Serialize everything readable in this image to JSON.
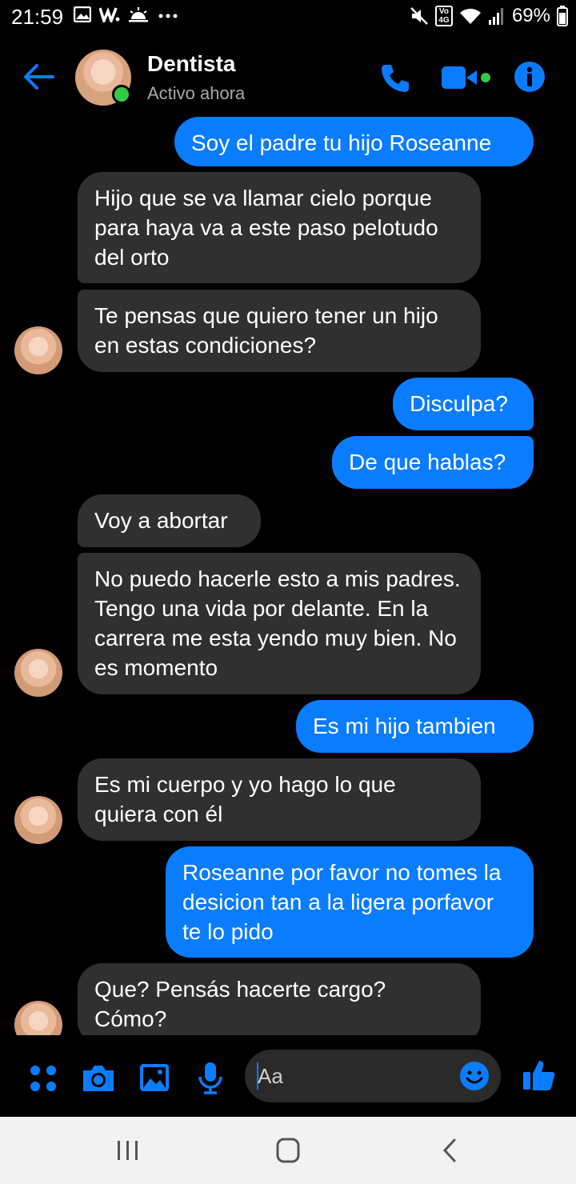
{
  "status_bar": {
    "time": "21:59",
    "battery": "69%",
    "network": "4G",
    "network_prefix": "Vo",
    "left_icons": [
      "gallery-icon",
      "w-app-icon",
      "weather-icon",
      "more-dots-icon"
    ],
    "right_icons": [
      "mute-icon",
      "volte-icon",
      "wifi-icon",
      "signal-icon",
      "battery-icon"
    ]
  },
  "header": {
    "contact_name": "Dentista",
    "contact_status": "Activo ahora",
    "accent": "#0a7cff",
    "online_color": "#31cc46"
  },
  "messages": [
    {
      "direction": "out",
      "text": "Soy el padre tu hijo Roseanne"
    },
    {
      "direction": "in",
      "text": "Hijo que se va llamar cielo porque para haya va a este paso pelotudo del orto"
    },
    {
      "direction": "in",
      "text": "Te pensas que quiero tener un hijo en estas condiciones?"
    },
    {
      "direction": "out",
      "text": "Disculpa?"
    },
    {
      "direction": "out",
      "text": "De que hablas?"
    },
    {
      "direction": "in",
      "text": "Voy a abortar"
    },
    {
      "direction": "in",
      "text": "No puedo hacerle esto a mis padres. Tengo una vida por delante. En la carrera me esta yendo muy bien. No es momento"
    },
    {
      "direction": "out",
      "text": "Es mi hijo tambien"
    },
    {
      "direction": "in",
      "text": "Es mi cuerpo y yo hago lo que quiera con él"
    },
    {
      "direction": "out",
      "text": "Roseanne por favor no tomes la desicion tan a la ligera porfavor te lo pido"
    },
    {
      "direction": "in",
      "text": "Que? Pensás hacerte cargo? Cómo?"
    }
  ],
  "composer": {
    "placeholder": "Aa",
    "icons": [
      "apps-icon",
      "camera-icon",
      "gallery-icon",
      "microphone-icon",
      "emoji-icon",
      "thumbs-up-icon"
    ]
  },
  "nav_bar": {
    "icons": [
      "recent-apps-icon",
      "home-icon",
      "back-icon"
    ]
  }
}
